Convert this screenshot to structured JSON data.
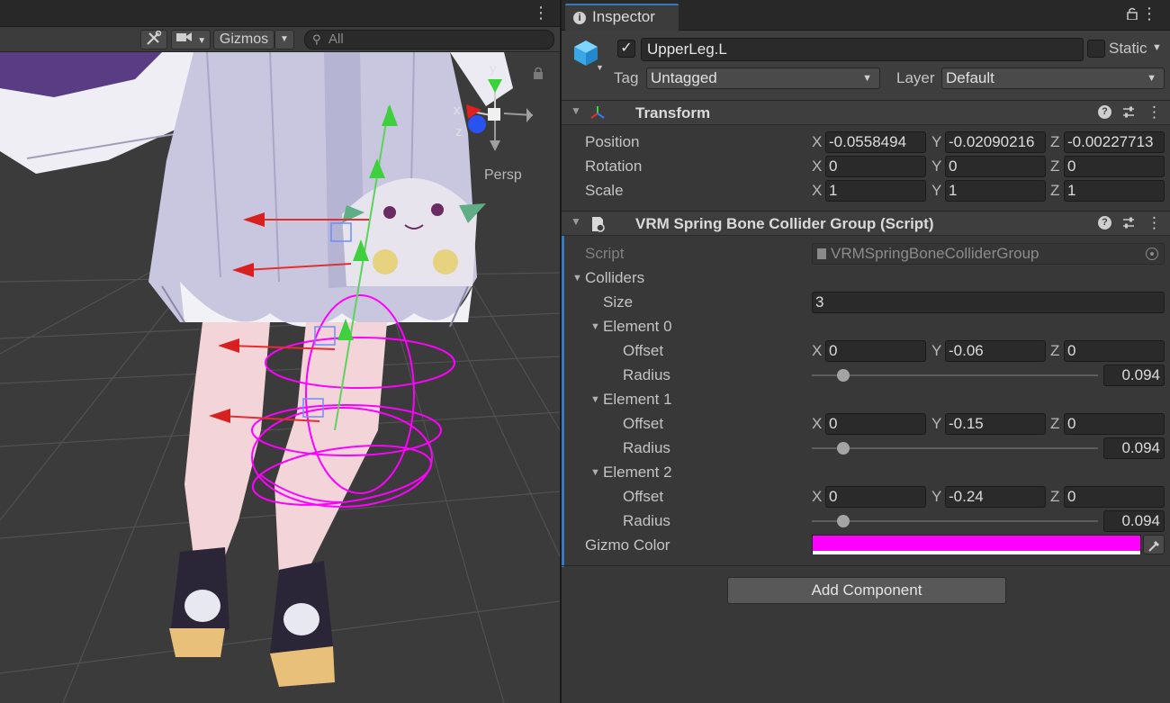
{
  "scene": {
    "toolbar": {
      "tools_icon": "tools-icon",
      "camera_icon": "camera-icon",
      "gizmos_label": "Gizmos",
      "search_placeholder": "All"
    },
    "orientation_gizmo": {
      "y_label": "y",
      "x_label": "x",
      "z_label": "z",
      "projection_label": "Persp"
    }
  },
  "inspector": {
    "tab_label": "Inspector",
    "game_object": {
      "active": true,
      "name": "UpperLeg.L",
      "static_label": "Static",
      "tag_label": "Tag",
      "tag_value": "Untagged",
      "layer_label": "Layer",
      "layer_value": "Default"
    },
    "transform": {
      "title": "Transform",
      "position": {
        "label": "Position",
        "x": "-0.0558494",
        "y": "-0.02090216",
        "z": "-0.00227713"
      },
      "rotation": {
        "label": "Rotation",
        "x": "0",
        "y": "0",
        "z": "0"
      },
      "scale": {
        "label": "Scale",
        "x": "1",
        "y": "1",
        "z": "1"
      }
    },
    "collider_group": {
      "title": "VRM Spring Bone Collider Group (Script)",
      "script_label": "Script",
      "script_value": "VRMSpringBoneColliderGroup",
      "colliders_label": "Colliders",
      "size_label": "Size",
      "size_value": "3",
      "offset_label": "Offset",
      "radius_label": "Radius",
      "elements": [
        {
          "label": "Element 0",
          "x": "0",
          "y": "-0.06",
          "z": "0",
          "radius": "0.094"
        },
        {
          "label": "Element 1",
          "x": "0",
          "y": "-0.15",
          "z": "0",
          "radius": "0.094"
        },
        {
          "label": "Element 2",
          "x": "0",
          "y": "-0.24",
          "z": "0",
          "radius": "0.094"
        }
      ],
      "gizmo_color_label": "Gizmo Color",
      "gizmo_color": "#ff00ff"
    },
    "add_component_label": "Add Component"
  },
  "axis_labels": {
    "x": "X",
    "y": "Y",
    "z": "Z"
  },
  "colors": {
    "accent": "#3a79bb",
    "gizmo": "#ff00ff"
  }
}
